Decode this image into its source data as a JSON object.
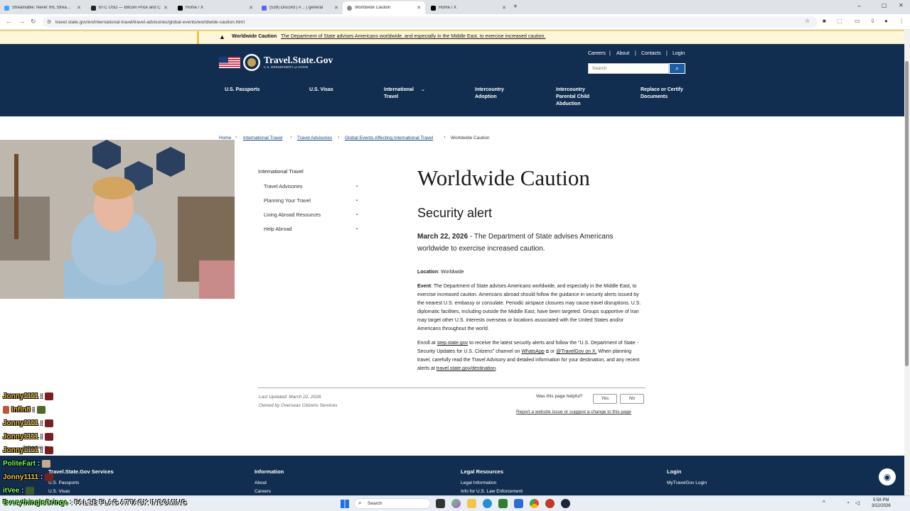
{
  "browser": {
    "tabs": [
      {
        "title": "Streamable: Never IRL Stream w",
        "color": "#3fa0ff",
        "active": false
      },
      {
        "title": "BTC USD — Bitcoin Price and C",
        "color": "#222222",
        "active": false
      },
      {
        "title": "Home / X",
        "color": "#000000",
        "active": false
      },
      {
        "title": "(539) Discord | #… | general",
        "color": "#5865f2",
        "active": false
      },
      {
        "title": "Worldwide Caution",
        "color": "#112e51",
        "active": true
      },
      {
        "title": "Home / X",
        "color": "#000000",
        "active": false
      }
    ],
    "new_tab": "+",
    "url": "travel.state.gov/en/international-travel/travel-advisories/global-events/worldwide-caution.html"
  },
  "alert": {
    "label": "Worldwide Caution",
    "text": "The Department of State advises Americans worldwide, and especially in the Middle East, to exercise increased caution."
  },
  "header": {
    "logo_title": "Travel.State.Gov",
    "logo_sub": "U.S. DEPARTMENT of STATE",
    "util": [
      "Careers",
      "About",
      "Contacts",
      "Login"
    ],
    "search_placeholder": "Search",
    "nav": {
      "passports": "U.S. Passports",
      "visas": "U.S. Visas",
      "intl_1": "International",
      "intl_2": "Travel",
      "adoption_1": "Intercountry",
      "adoption_2": "Adoption",
      "abduction_1": "Intercountry",
      "abduction_2": "Parental Child",
      "abduction_3": "Abduction",
      "replace_1": "Replace or Certify",
      "replace_2": "Documents"
    }
  },
  "breadcrumb": {
    "home": "Home",
    "intl": "International Travel",
    "advisories": "Travel Advisories",
    "global": "Global Events Affecting International Travel",
    "current": "Worldwide Caution"
  },
  "sidebar": {
    "title": "International Travel",
    "items": [
      "Travel Advisories",
      "Planning Your Travel",
      "Living Abroad Resources",
      "Help Abroad"
    ]
  },
  "main": {
    "title": "Worldwide Caution",
    "subtitle": "Security alert",
    "date": "March 22, 2026",
    "lead": " - The Department of State advises Americans worldwide to exercise increased caution.",
    "location_label": "Location",
    "location": ": Worldwide",
    "event_label": "Event",
    "event": ": The Department of State advises Americans worldwide, and especially in the Middle East, to exercise increased caution.  Americans abroad should follow the guidance in security alerts issued by the nearest U.S. embassy or consulate.  Periodic airspace closures may cause travel disruptions.  U.S. diplomatic facilities, including outside the Middle East, have been targeted.  Groups supportive of Iran may target other U.S. interests overseas or locations associated with the United States and/or Americans throughout the world.",
    "enroll_1": "Enroll at ",
    "enroll_link": "step.state.gov",
    "enroll_2": " to receive the latest security alerts and follow the \"U.S. Department of State - Security Updates for U.S. Citizens\" channel on ",
    "whatsapp": "WhatsApp",
    "enroll_3": " or ",
    "twitter": "@TravelGov on X.",
    "enroll_4": "  When planning travel, carefully read the Travel Advisory and detailed information for your destination, and any recent alerts at ",
    "destination_link": "travel.state.gov/destination",
    "enroll_5": ".",
    "last_updated": "Last Updated: March 22, 2026",
    "owned_by": "Owned by Overseas Citizens Services",
    "helpful_q": "Was this page helpful?",
    "yes": "Yes",
    "no": "No",
    "report": "Report a website issue or suggest a change to this page"
  },
  "chat": [
    {
      "user": "Jonny1111",
      "sep": " :",
      "color": "#f5c542",
      "emote": "#7a1f1f"
    },
    {
      "user": "Infin8",
      "sep": " :",
      "color": "#f5c542",
      "emote": "#4a6b2a",
      "badge": true
    },
    {
      "user": "Jonny1111",
      "sep": " :",
      "color": "#f5c542",
      "emote": "#7a1f1f"
    },
    {
      "user": "Jonny1111",
      "sep": " :",
      "color": "#f5c542",
      "emote": "#7a1f1f"
    },
    {
      "user": "Jonny1111",
      "sep": " :",
      "color": "#f5c542",
      "emote": "#7a1f1f",
      "overlay": "Sebastian to"
    },
    {
      "user": "PoliteFart",
      "sep": " :",
      "color": "#7cfc5a",
      "emote": "#c8a98a"
    },
    {
      "user": "Jonny1111",
      "sep": " :",
      "color": "#f5c542",
      "emote": "#7a1f1f"
    },
    {
      "user": "itVee",
      "sep": " :",
      "color": "#7cfc5a",
      "emote": "#3a5a2a"
    }
  ],
  "ticker": {
    "user": "EverythingIsCringe",
    "text": " : FALSE FLAG ATTACK INCOMING",
    "user_color": "#7cfc5a"
  },
  "footer": {
    "col1_head": "Travel.State.Gov Services",
    "col1_links": [
      "U.S. Passports",
      "U.S. Visas"
    ],
    "col2_head": "Information",
    "col2_links": [
      "About",
      "Careers"
    ],
    "col3_head": "Legal Resources",
    "col3_links": [
      "Legal Information",
      "Info for U.S. Law Enforcement"
    ],
    "col4_head": "Login",
    "col4_links": [
      "MyTravelGov Login"
    ]
  },
  "taskbar": {
    "search": "Search",
    "time": "5:58 PM",
    "date": "3/22/2026"
  }
}
